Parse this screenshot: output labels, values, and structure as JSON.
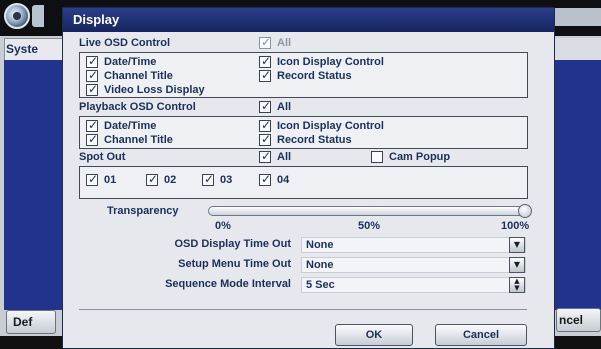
{
  "background": {
    "sidebar_tab": "Syste",
    "left_button": "Def",
    "right_button": "ncel"
  },
  "dialog": {
    "title": "Display",
    "live_osd": {
      "label": "Live OSD Control",
      "all_label": "All",
      "all_checked": true,
      "options": [
        {
          "label": "Date/Time",
          "checked": true
        },
        {
          "label": "Icon Display Control",
          "checked": true
        },
        {
          "label": "Channel Title",
          "checked": true
        },
        {
          "label": "Record Status",
          "checked": true
        },
        {
          "label": "Video Loss Display",
          "checked": true
        }
      ]
    },
    "playback_osd": {
      "label": "Playback OSD Control",
      "all_label": "All",
      "all_checked": true,
      "options": [
        {
          "label": "Date/Time",
          "checked": true
        },
        {
          "label": "Icon Display Control",
          "checked": true
        },
        {
          "label": "Channel Title",
          "checked": true
        },
        {
          "label": "Record Status",
          "checked": true
        }
      ]
    },
    "spot_out": {
      "label": "Spot Out",
      "all_label": "All",
      "all_checked": true,
      "cam_popup_label": "Cam Popup",
      "cam_popup_checked": false,
      "channels": [
        {
          "label": "01",
          "checked": true
        },
        {
          "label": "02",
          "checked": true
        },
        {
          "label": "03",
          "checked": true
        },
        {
          "label": "04",
          "checked": true
        }
      ]
    },
    "transparency": {
      "label": "Transparency",
      "value_percent": 100,
      "ticks": [
        "0%",
        "50%",
        "100%"
      ]
    },
    "osd_display_time_out": {
      "label": "OSD Display Time Out",
      "value": "None"
    },
    "setup_menu_time_out": {
      "label": "Setup Menu Time Out",
      "value": "None"
    },
    "sequence_mode_interval": {
      "label": "Sequence Mode Interval",
      "value": "5 Sec"
    },
    "ok_label": "OK",
    "cancel_label": "Cancel"
  }
}
